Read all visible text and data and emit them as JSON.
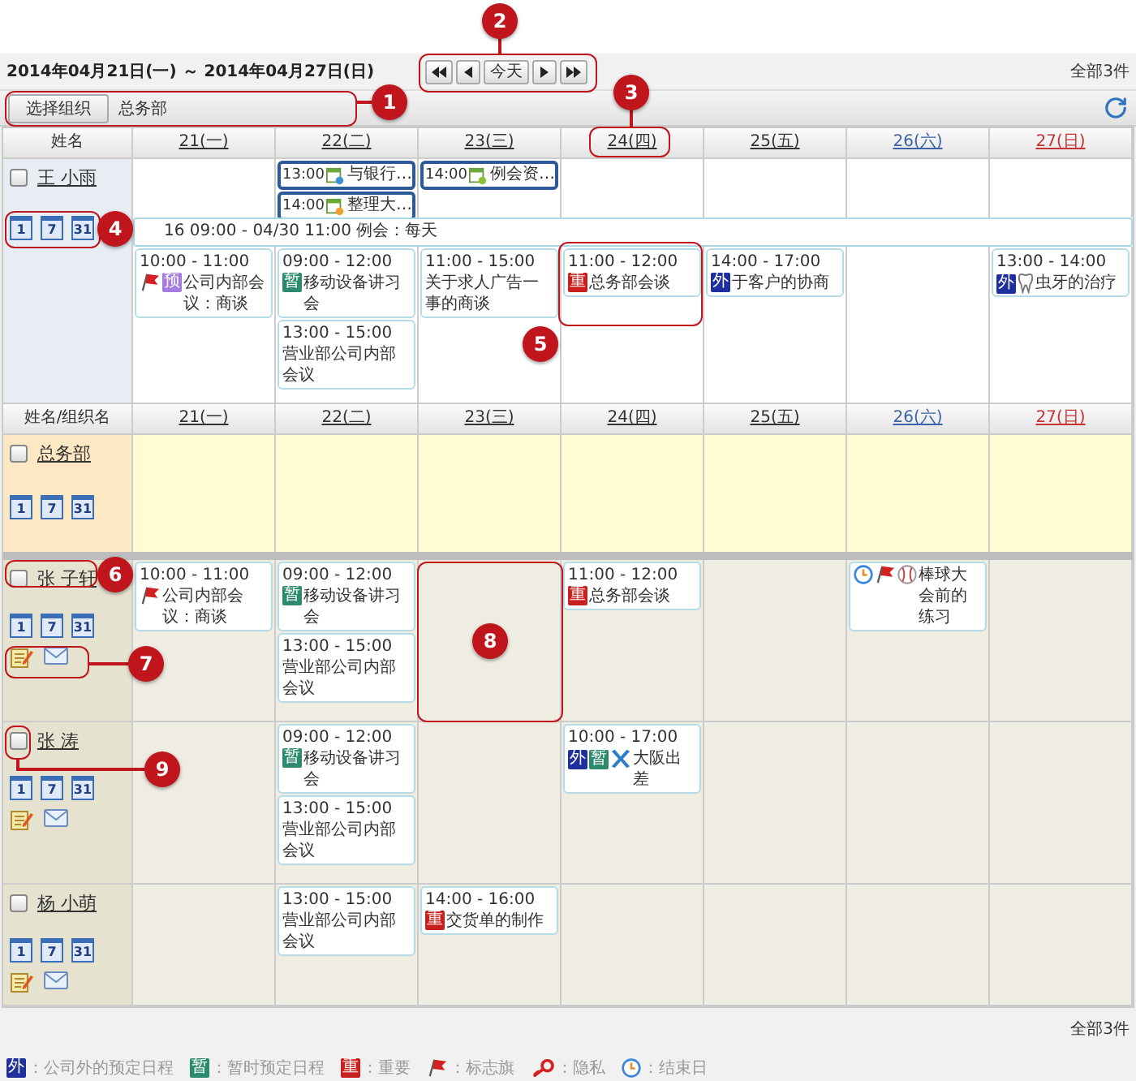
{
  "toolbar": {
    "date_range": "2014年04月21日(一) ～ 2014年04月27日(日)",
    "today_button": "今天",
    "total": "全部3件"
  },
  "org_bar": {
    "button": "选择组织",
    "org_name": "总务部"
  },
  "days": [
    {
      "label": "21(一)",
      "kind": "weekday"
    },
    {
      "label": "22(二)",
      "kind": "weekday"
    },
    {
      "label": "23(三)",
      "kind": "weekday"
    },
    {
      "label": "24(四)",
      "kind": "weekday"
    },
    {
      "label": "25(五)",
      "kind": "weekday"
    },
    {
      "label": "26(六)",
      "kind": "saturday"
    },
    {
      "label": "27(日)",
      "kind": "sunday"
    }
  ],
  "personal": {
    "column_label": "姓名",
    "name": "王 小雨",
    "checked": false,
    "views": [
      "1",
      "7",
      "31"
    ],
    "banner_cells": [
      {
        "kind": "free"
      },
      {
        "kind": "busy",
        "events": [
          {
            "time": "13:00",
            "title": "与银行…",
            "color": "#3a8fd8"
          },
          {
            "time": "14:00",
            "title": "整理大…",
            "color": "#f0a030"
          }
        ]
      },
      {
        "kind": "busy",
        "events": [
          {
            "time": "14:00",
            "title": "例会资…",
            "color": "#8fbf3a"
          }
        ]
      },
      {
        "kind": "free"
      },
      {
        "kind": "free"
      },
      {
        "kind": "free"
      },
      {
        "kind": "free"
      }
    ],
    "span_event": "16 09:00 - 04/30 11:00 例会：每天",
    "event_cells": [
      {
        "kind": "busy",
        "events": [
          {
            "time": "10:00 - 11:00",
            "marks": [
              {
                "kind": "flag"
              },
              {
                "kind": "tag",
                "text": "预",
                "color": "#a57be0"
              }
            ],
            "title": "公司内部会议：商谈"
          }
        ]
      },
      {
        "kind": "busy",
        "events": [
          {
            "time": "09:00 - 12:00",
            "marks": [
              {
                "kind": "tag",
                "text": "暂",
                "color": "#2e8a6e"
              }
            ],
            "title": "移动设备讲习会"
          },
          {
            "time": "13:00 - 15:00",
            "title": "营业部公司内部会议"
          }
        ]
      },
      {
        "kind": "busy",
        "events": [
          {
            "time": "11:00 - 15:00",
            "title": "关于求人广告一事的商谈"
          }
        ]
      },
      {
        "kind": "busy",
        "events": [
          {
            "time": "11:00 - 12:00",
            "marks": [
              {
                "kind": "tag",
                "text": "重",
                "color": "#c8201e"
              }
            ],
            "title": "总务部会谈"
          }
        ]
      },
      {
        "kind": "busy",
        "events": [
          {
            "time": "14:00 - 17:00",
            "marks": [
              {
                "kind": "tag",
                "text": "外",
                "color": "#1f2f9e"
              }
            ],
            "title": "于客户的协商"
          }
        ]
      },
      {
        "kind": "free"
      },
      {
        "kind": "busy",
        "events": [
          {
            "time": "13:00 - 14:00",
            "marks": [
              {
                "kind": "tag",
                "text": "外",
                "color": "#1f2f9e"
              },
              {
                "kind": "tooth"
              }
            ],
            "title": "虫牙的治疗"
          }
        ]
      }
    ]
  },
  "group": {
    "column_label": "姓名/组织名",
    "days": [
      {
        "label": "21(一)",
        "kind": "weekday"
      },
      {
        "label": "22(二)",
        "kind": "weekday"
      },
      {
        "label": "23(三)",
        "kind": "weekday"
      },
      {
        "label": "24(四)",
        "kind": "weekday"
      },
      {
        "label": "25(五)",
        "kind": "weekday"
      },
      {
        "label": "26(六)",
        "kind": "saturday"
      },
      {
        "label": "27(日)",
        "kind": "sunday"
      }
    ],
    "org_row": {
      "name": "总务部",
      "checked": false,
      "views": [
        "1",
        "7",
        "31"
      ]
    },
    "members": [
      {
        "name": "张 子轩",
        "checked": false,
        "views": [
          "1",
          "7",
          "31"
        ],
        "cells": [
          {
            "kind": "busy",
            "events": [
              {
                "time": "10:00 - 11:00",
                "marks": [
                  {
                    "kind": "flag"
                  }
                ],
                "title": "公司内部会议：商谈"
              }
            ]
          },
          {
            "kind": "busy",
            "events": [
              {
                "time": "09:00 - 12:00",
                "marks": [
                  {
                    "kind": "tag",
                    "text": "暂",
                    "color": "#2e8a6e"
                  }
                ],
                "title": "移动设备讲习会"
              },
              {
                "time": "13:00 - 15:00",
                "title": "营业部公司内部会议"
              }
            ]
          },
          {
            "kind": "free"
          },
          {
            "kind": "busy",
            "events": [
              {
                "time": "11:00 - 12:00",
                "marks": [
                  {
                    "kind": "tag",
                    "text": "重",
                    "color": "#c8201e"
                  }
                ],
                "title": "总务部会谈"
              }
            ]
          },
          {
            "kind": "free"
          },
          {
            "kind": "busy",
            "events": [
              {
                "marks": [
                  {
                    "kind": "end"
                  },
                  {
                    "kind": "flag"
                  },
                  {
                    "kind": "baseball"
                  }
                ],
                "title": "棒球大会前的练习"
              }
            ]
          },
          {
            "kind": "free"
          }
        ]
      },
      {
        "name": "张 涛",
        "checked": false,
        "views": [
          "1",
          "7",
          "31"
        ],
        "cells": [
          {
            "kind": "free"
          },
          {
            "kind": "busy",
            "events": [
              {
                "time": "09:00 - 12:00",
                "marks": [
                  {
                    "kind": "tag",
                    "text": "暂",
                    "color": "#2e8a6e"
                  }
                ],
                "title": "移动设备讲习会"
              },
              {
                "time": "13:00 - 15:00",
                "title": "营业部公司内部会议"
              }
            ]
          },
          {
            "kind": "free"
          },
          {
            "kind": "busy",
            "events": [
              {
                "time": "10:00 - 17:00",
                "marks": [
                  {
                    "kind": "tag",
                    "text": "外",
                    "color": "#1f2f9e"
                  },
                  {
                    "kind": "tag",
                    "text": "暂",
                    "color": "#2e8a6e"
                  },
                  {
                    "kind": "plane"
                  }
                ],
                "title": "大阪出差"
              }
            ]
          },
          {
            "kind": "free"
          },
          {
            "kind": "free"
          },
          {
            "kind": "free"
          }
        ]
      },
      {
        "name": "杨 小萌",
        "checked": false,
        "views": [
          "1",
          "7",
          "31"
        ],
        "cells": [
          {
            "kind": "free"
          },
          {
            "kind": "busy",
            "events": [
              {
                "time": "13:00 - 15:00",
                "title": "营业部公司内部会议"
              }
            ]
          },
          {
            "kind": "busy",
            "events": [
              {
                "time": "14:00 - 16:00",
                "marks": [
                  {
                    "kind": "tag",
                    "text": "重",
                    "color": "#c8201e"
                  }
                ],
                "title": "交货单的制作"
              }
            ]
          },
          {
            "kind": "free"
          },
          {
            "kind": "free"
          },
          {
            "kind": "free"
          },
          {
            "kind": "free"
          }
        ]
      }
    ]
  },
  "footer_total": "全部3件",
  "legend": [
    {
      "marks": [
        {
          "kind": "tag",
          "text": "外",
          "color": "#1f2f9e"
        }
      ],
      "text": "：公司外的预定日程"
    },
    {
      "marks": [
        {
          "kind": "tag",
          "text": "暂",
          "color": "#2e8a6e"
        }
      ],
      "text": "：暂时预定日程"
    },
    {
      "marks": [
        {
          "kind": "tag",
          "text": "重",
          "color": "#c8201e"
        }
      ],
      "text": "：重要"
    },
    {
      "marks": [
        {
          "kind": "flag"
        }
      ],
      "text": "：标志旗"
    },
    {
      "marks": [
        {
          "kind": "key"
        }
      ],
      "text": "：隐私"
    },
    {
      "marks": [
        {
          "kind": "end"
        }
      ],
      "text": "：结束日"
    }
  ],
  "callouts": [
    "1",
    "2",
    "3",
    "4",
    "5",
    "6",
    "7",
    "8",
    "9"
  ]
}
